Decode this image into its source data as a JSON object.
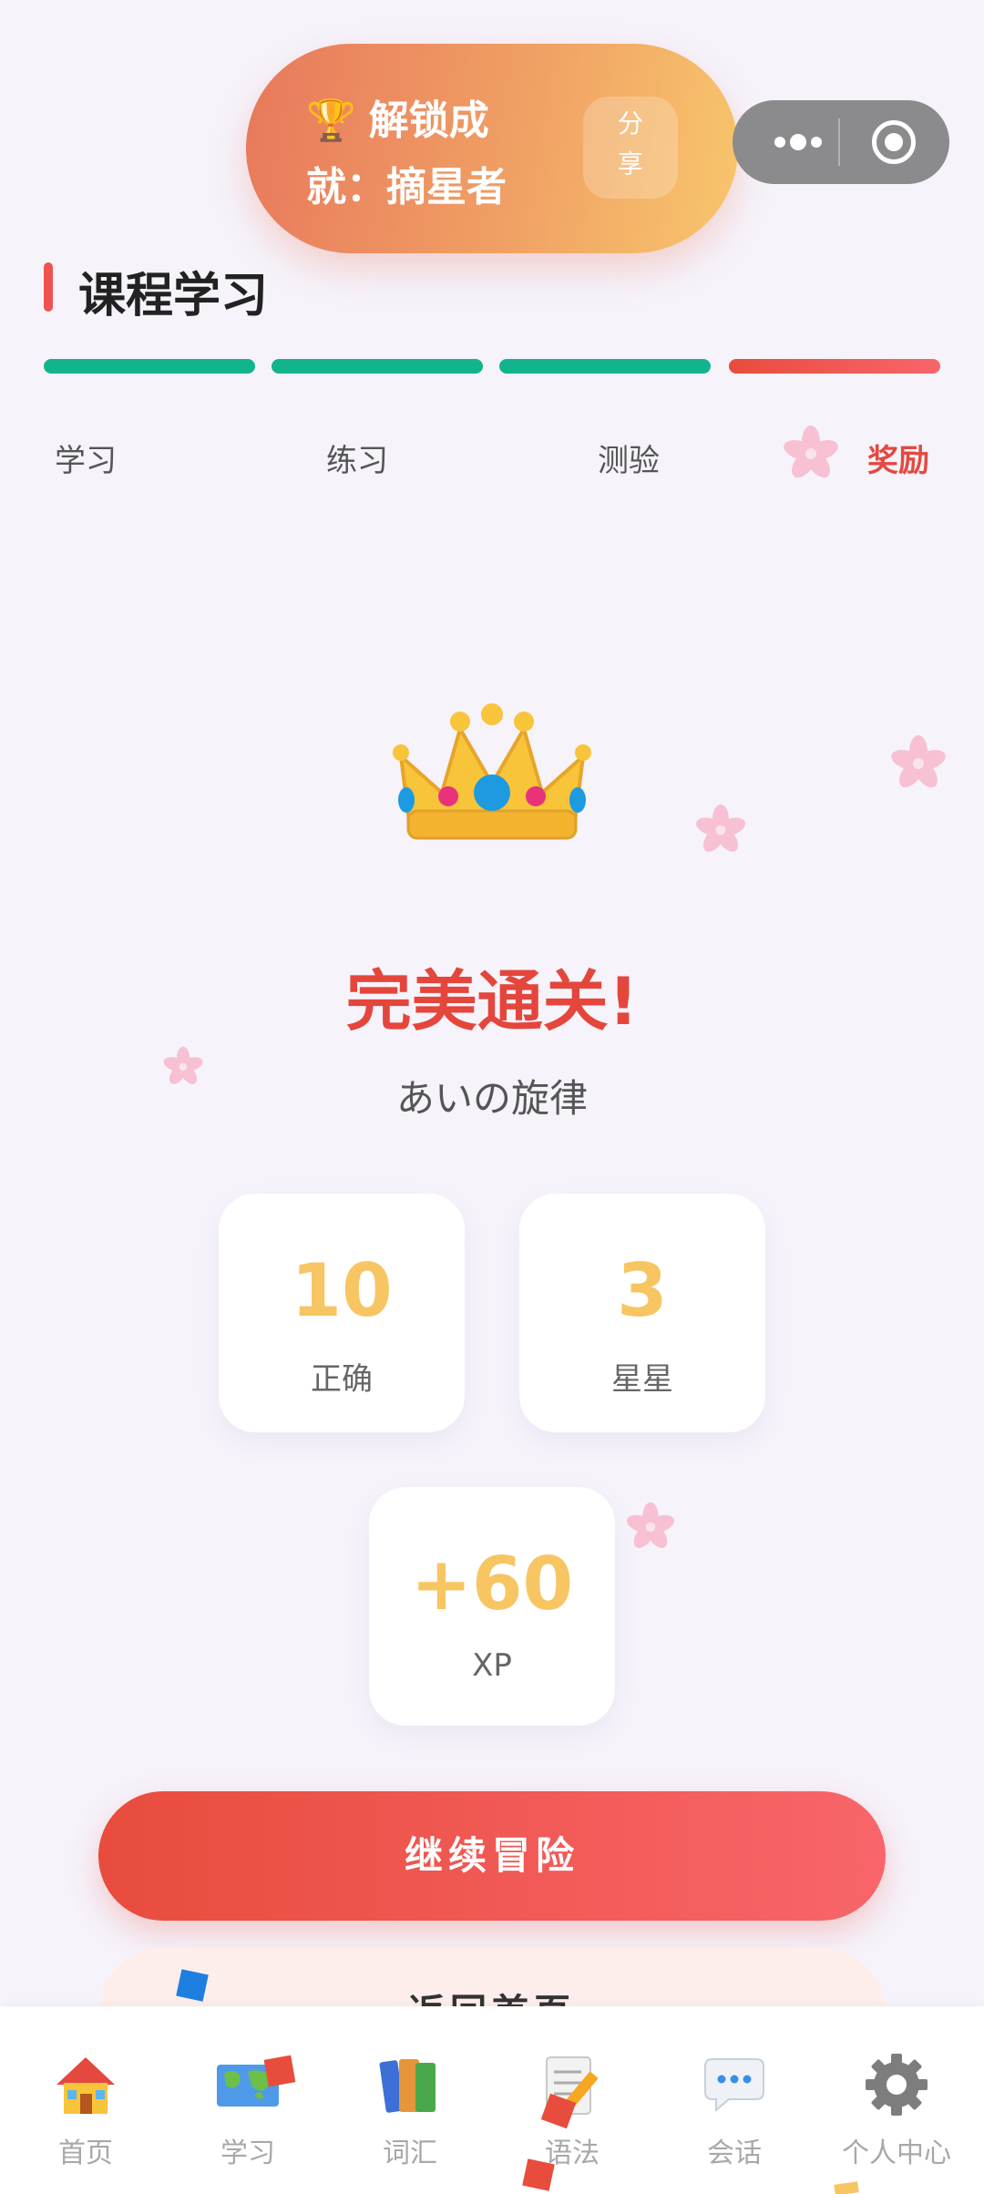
{
  "toast": {
    "trophy_icon": "🏆",
    "text": "解锁成就：摘星者",
    "share_label": "分享"
  },
  "header": {
    "title": "课程学习"
  },
  "steps": [
    {
      "label": "学习",
      "color": "#12b48d",
      "active": false
    },
    {
      "label": "练习",
      "color": "#12b48d",
      "active": false
    },
    {
      "label": "测验",
      "color": "#12b48d",
      "active": false
    },
    {
      "label": "奖励",
      "color": "#ef5350",
      "active": true
    }
  ],
  "result": {
    "icon": "crown-icon",
    "headline": "完美通关!",
    "subtitle": "あいの旋律"
  },
  "stats": [
    {
      "value": "10",
      "label": "正确"
    },
    {
      "value": "3",
      "label": "星星"
    },
    {
      "value": "+60",
      "label": "XP"
    }
  ],
  "buttons": {
    "continue": "继续冒险",
    "back_home": "返回首页"
  },
  "tabbar": [
    {
      "label": "首页",
      "icon": "house-icon"
    },
    {
      "label": "学习",
      "icon": "world-map-icon"
    },
    {
      "label": "词汇",
      "icon": "books-icon"
    },
    {
      "label": "语法",
      "icon": "memo-pencil-icon"
    },
    {
      "label": "会话",
      "icon": "speech-bubble-icon"
    },
    {
      "label": "个人中心",
      "icon": "gear-icon"
    }
  ],
  "colors": {
    "accent_red": "#e4463c",
    "teal": "#12b48d",
    "gold": "#f8c563",
    "background": "#f6f3fb"
  }
}
